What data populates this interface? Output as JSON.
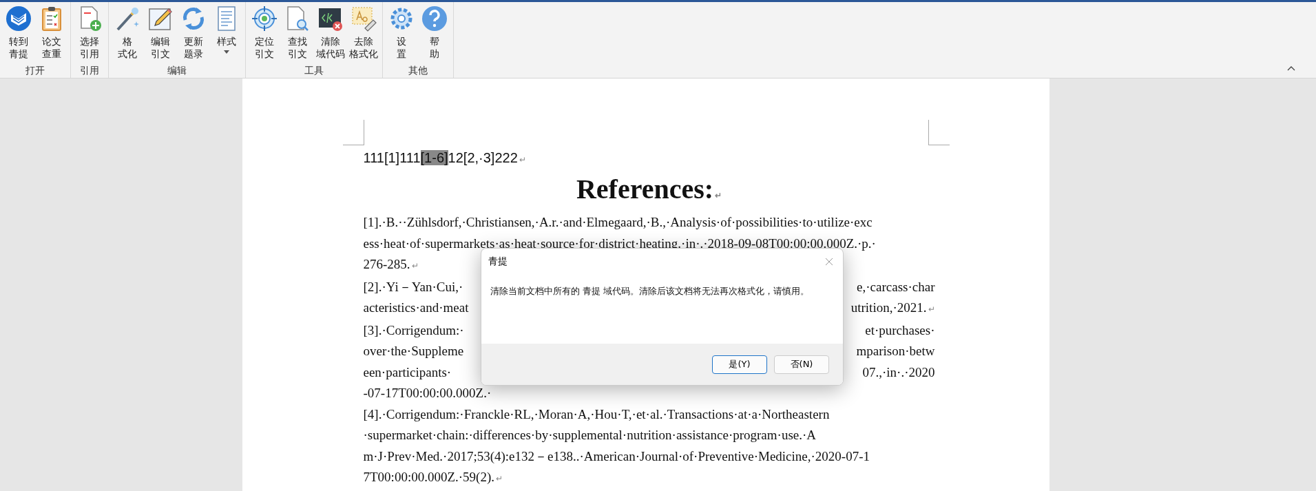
{
  "ribbon": {
    "groups": [
      {
        "label": "打开",
        "buttons": [
          {
            "lines": [
              "转到",
              "青提"
            ],
            "kind": "logo",
            "has_menu": false
          },
          {
            "lines": [
              "论文",
              "查重"
            ],
            "kind": "clipboard",
            "has_menu": false
          }
        ]
      },
      {
        "label": "引用",
        "buttons": [
          {
            "lines": [
              "选择",
              "引用"
            ],
            "kind": "doc-plus",
            "has_menu": false
          }
        ]
      },
      {
        "label": "编辑",
        "buttons": [
          {
            "lines": [
              "格",
              "式化"
            ],
            "kind": "wand",
            "has_menu": false
          },
          {
            "lines": [
              "编辑",
              "引文"
            ],
            "kind": "pencil",
            "has_menu": false
          },
          {
            "lines": [
              "更新",
              "题录"
            ],
            "kind": "refresh",
            "has_menu": false
          },
          {
            "lines": [
              "样式"
            ],
            "kind": "list-doc",
            "has_menu": true
          }
        ]
      },
      {
        "label": "工具",
        "buttons": [
          {
            "lines": [
              "定位",
              "引文"
            ],
            "kind": "target",
            "has_menu": false
          },
          {
            "lines": [
              "查找",
              "引文"
            ],
            "kind": "doc-search",
            "has_menu": false
          },
          {
            "lines": [
              "清除",
              "域代码"
            ],
            "kind": "code-x",
            "has_menu": false
          },
          {
            "lines": [
              "去除",
              "格式化"
            ],
            "kind": "eraser",
            "has_menu": false
          }
        ]
      },
      {
        "label": "其他",
        "buttons": [
          {
            "lines": [
              "设",
              "置"
            ],
            "kind": "gear",
            "has_menu": false
          },
          {
            "lines": [
              "帮",
              "助"
            ],
            "kind": "help",
            "has_menu": false
          }
        ]
      }
    ]
  },
  "document": {
    "lines": [
      {
        "kind": "citation",
        "before": "111[1]111",
        "highlight": "[1-6]",
        "after": "12[2,·3]222",
        "end_mark": "↵"
      },
      {
        "kind": "heading",
        "text": "References:",
        "end_mark": "↵"
      },
      {
        "kind": "text",
        "text": "[1].·B.··Zühlsdorf,·Christiansen,·A.r.·and·Elmegaard,·B.,·Analysis·of·possibilities·to·utilize·exc"
      },
      {
        "kind": "text",
        "text": "ess·heat·of·supermarkets·as·heat·source·for·district·heating.·in·.·2018-09-08T00:00:00.000Z.·p.·"
      },
      {
        "kind": "text",
        "text": "276-285.",
        "end_mark": "↵"
      },
      {
        "kind": "split",
        "left": "[2].·Yi－Yan·Cui,·",
        "right": "e,·carcass·char"
      },
      {
        "kind": "split",
        "left": "acteristics·and·meat",
        "right": "utrition,·2021.",
        "end_mark": "↵"
      },
      {
        "kind": "split",
        "left": "[3].·Corrigendum:·",
        "right": "et·purchases·"
      },
      {
        "kind": "split",
        "left": "over·the·Suppleme",
        "right": "mparison·betw"
      },
      {
        "kind": "split",
        "left": "een·participants·",
        "right": "07.,·in·.·2020"
      },
      {
        "kind": "text",
        "text": "-07-17T00:00:00.000Z.·"
      },
      {
        "kind": "text",
        "text": "[4].·Corrigendum:·Franckle·RL,·Moran·A,·Hou·T,·et·al.·Transactions·at·a·Northeastern"
      },
      {
        "kind": "text",
        "text": "·supermarket·chain:·differences·by·supplemental·nutrition·assistance·program·use.·A"
      },
      {
        "kind": "text",
        "text": "m·J·Prev·Med.·2017;53(4):e132－e138..·American·Journal·of·Preventive·Medicine,·2020-07-1"
      },
      {
        "kind": "text",
        "text": "7T00:00:00.000Z.·59(2).",
        "end_mark": "↵"
      }
    ]
  },
  "dialog": {
    "title": "青提",
    "message": "清除当前文档中所有的 青提 域代码。清除后该文档将无法再次格式化，请慎用。",
    "buttons": [
      {
        "label": "是(Y)",
        "default": true
      },
      {
        "label": "否(N)",
        "default": false
      }
    ]
  }
}
